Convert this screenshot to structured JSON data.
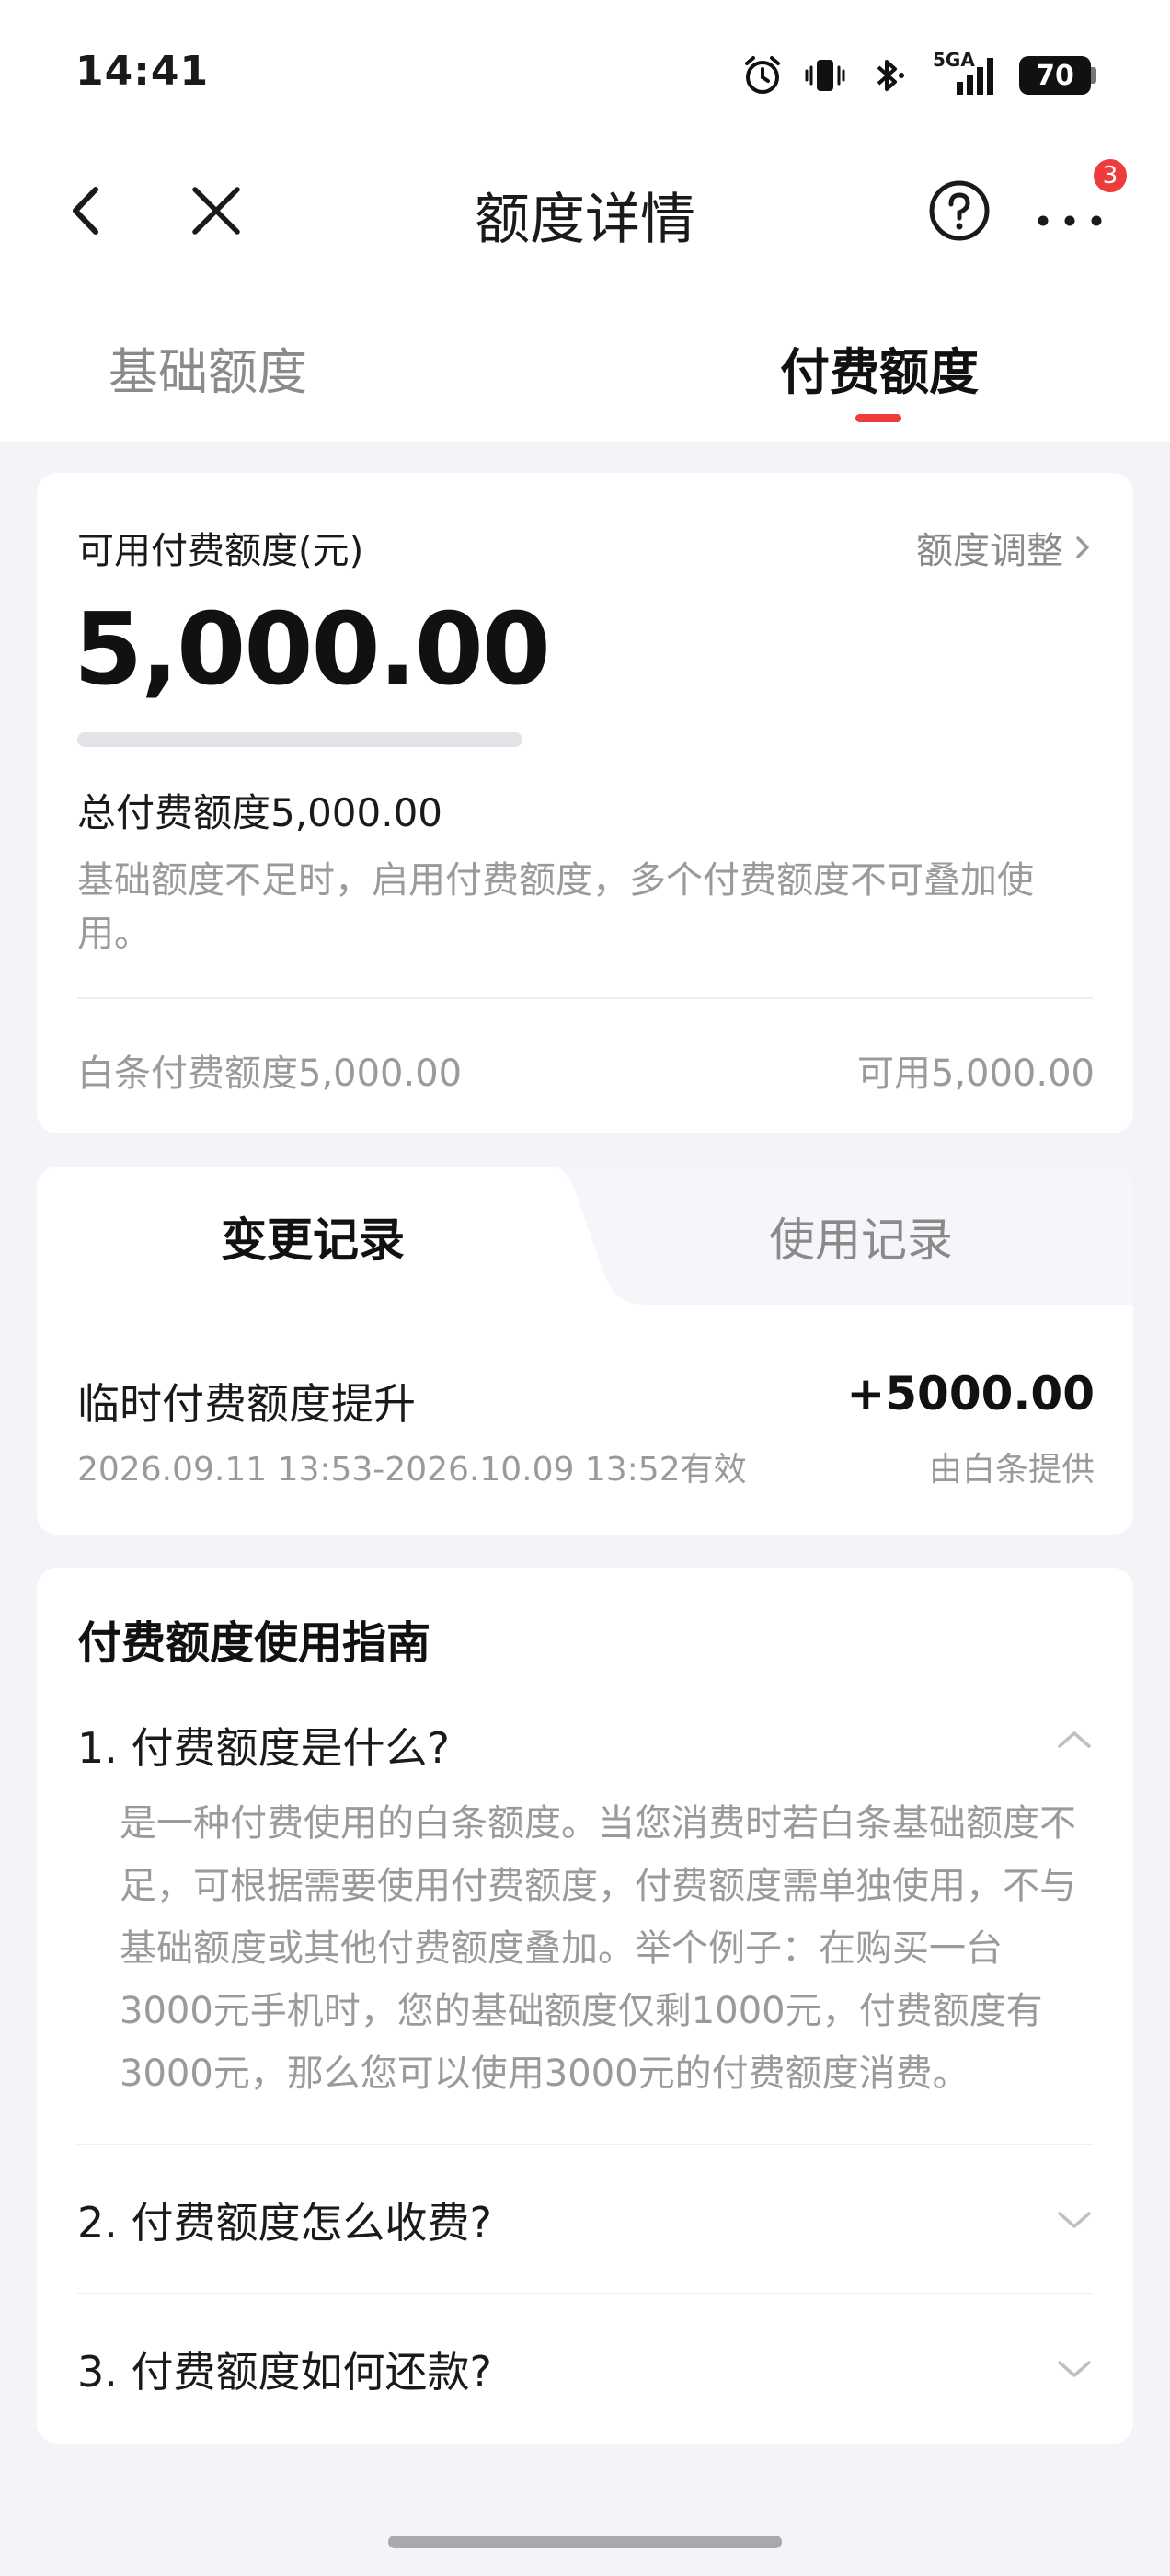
{
  "status_bar": {
    "time": "14:41",
    "network": "5GA",
    "battery": "70"
  },
  "nav": {
    "title": "额度详情",
    "badge_count": "3"
  },
  "tabs": [
    {
      "label": "基础额度",
      "active": false
    },
    {
      "label": "付费额度",
      "active": true
    }
  ],
  "credit": {
    "label": "可用付费额度(元)",
    "adjust_label": "额度调整",
    "amount": "5,000.00",
    "used_fraction": 0.0,
    "total_line": "总付费额度5,000.00",
    "description": "基础额度不足时，启用付费额度，多个付费额度不可叠加使用。",
    "baitiao_line": "白条付费额度5,000.00",
    "available_line": "可用5,000.00"
  },
  "records": {
    "tabs": [
      {
        "label": "变更记录",
        "active": true
      },
      {
        "label": "使用记录",
        "active": false
      }
    ],
    "items": [
      {
        "title": "临时付费额度提升",
        "amount": "+5000.00",
        "period": "2026.09.11 13:53-2026.10.09 13:52有效",
        "provider": "由白条提供"
      }
    ]
  },
  "guide": {
    "title": "付费额度使用指南",
    "faqs": [
      {
        "question": "1. 付费额度是什么?",
        "expanded": true,
        "answer": "是一种付费使用的白条额度。当您消费时若白条基础额度不足，可根据需要使用付费额度，付费额度需单独使用，不与基础额度或其他付费额度叠加。举个例子：在购买一台3000元手机时，您的基础额度仅剩1000元，付费额度有3000元，那么您可以使用3000元的付费额度消费。"
      },
      {
        "question": "2. 付费额度怎么收费?",
        "expanded": false
      },
      {
        "question": "3. 付费额度如何还款?",
        "expanded": false
      }
    ]
  },
  "colors": {
    "accent": "#ee3b3b",
    "muted_text": "#9a9a9a",
    "background": "#f3f3f8"
  }
}
